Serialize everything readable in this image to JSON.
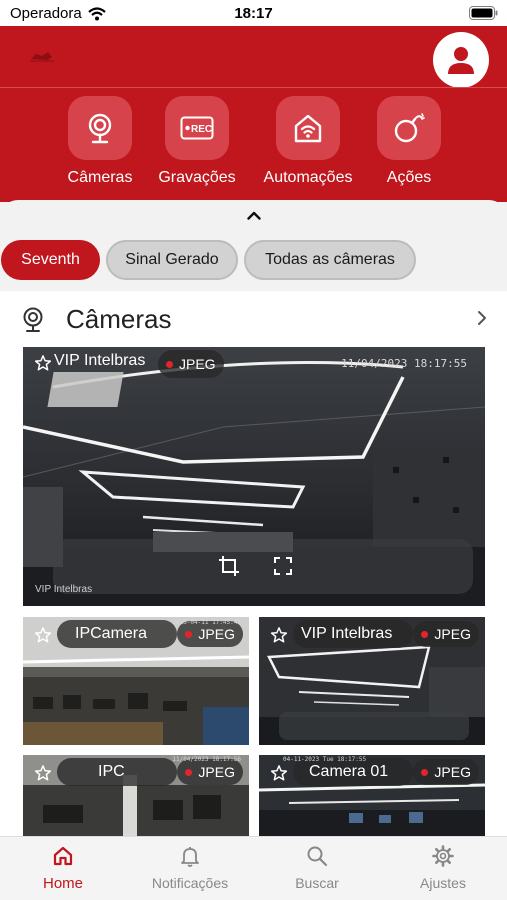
{
  "status_bar": {
    "carrier": "Operadora",
    "time": "18:17"
  },
  "header": {
    "actions": [
      {
        "label": "Câmeras",
        "icon": "webcam-icon"
      },
      {
        "label": "Gravações",
        "icon": "rec-icon"
      },
      {
        "label": "Automações",
        "icon": "smart-home-icon"
      },
      {
        "label": "Ações",
        "icon": "bomb-icon"
      }
    ]
  },
  "filters": [
    "Seventh",
    "Sinal Gerado",
    "Todas as câmeras"
  ],
  "section": {
    "title": "Câmeras"
  },
  "cameras": [
    {
      "name": "VIP Intelbras",
      "format": "JPEG",
      "timestamp": "11/04/2023 18:17:55",
      "overlay": "VIP Intelbras"
    },
    {
      "name": "IPCamera",
      "format": "JPEG",
      "timestamp": "2023-04-11 17:45:49"
    },
    {
      "name": "VIP Intelbras",
      "format": "JPEG"
    },
    {
      "name": "IPC",
      "format": "JPEG",
      "timestamp": "11/04/2023 18:17:56"
    },
    {
      "name": "Camera 01",
      "format": "JPEG",
      "timestamp": "04-11-2023 Tue 18:17:55"
    }
  ],
  "tabbar": [
    {
      "label": "Home",
      "icon": "home-icon",
      "active": true
    },
    {
      "label": "Notificações",
      "icon": "bell-icon"
    },
    {
      "label": "Buscar",
      "icon": "search-icon"
    },
    {
      "label": "Ajustes",
      "icon": "gear-icon"
    }
  ],
  "colors": {
    "brand": "#c0161d",
    "tile": "#d7434a",
    "rec_dot": "#e2252d"
  }
}
